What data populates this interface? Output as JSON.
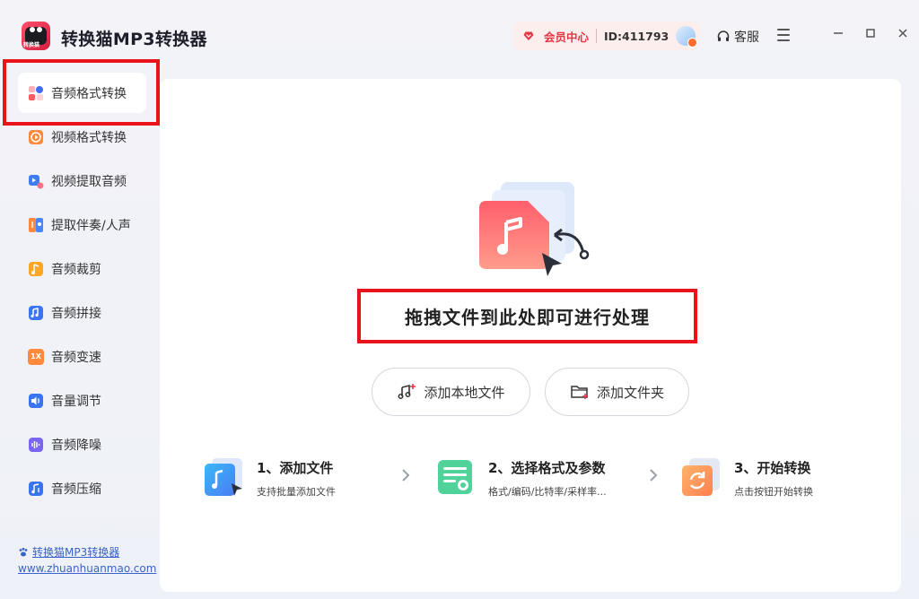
{
  "app": {
    "title": "转换猫MP3转换器",
    "logo_text": "转换猫"
  },
  "header": {
    "vip_label": "会员中心",
    "user_id": "ID:411793",
    "service_label": "客服"
  },
  "sidebar": {
    "items": [
      {
        "label": "音频格式转换",
        "icon": "audio-convert-icon",
        "active": true
      },
      {
        "label": "视频格式转换",
        "icon": "video-convert-icon"
      },
      {
        "label": "视频提取音频",
        "icon": "video-extract-audio-icon"
      },
      {
        "label": "提取伴奏/人声",
        "icon": "vocal-extract-icon"
      },
      {
        "label": "音频裁剪",
        "icon": "audio-cut-icon"
      },
      {
        "label": "音频拼接",
        "icon": "audio-merge-icon"
      },
      {
        "label": "音频变速",
        "icon": "audio-speed-icon"
      },
      {
        "label": "音量调节",
        "icon": "volume-icon"
      },
      {
        "label": "音频降噪",
        "icon": "denoise-icon"
      },
      {
        "label": "音频压缩",
        "icon": "compress-icon"
      }
    ],
    "speed_icon_text": "1X",
    "footer_brand": "转换猫MP3转换器",
    "footer_url": "www.zhuanhuanmao.com"
  },
  "main": {
    "drop_text": "拖拽文件到此处即可进行处理",
    "add_file_button": "添加本地文件",
    "add_folder_button": "添加文件夹",
    "steps": [
      {
        "title": "1、添加文件",
        "subtitle": "支持批量添加文件"
      },
      {
        "title": "2、选择格式及参数",
        "subtitle": "格式/编码/比特率/采样率..."
      },
      {
        "title": "3、开始转换",
        "subtitle": "点击按钮开始转换"
      }
    ]
  },
  "colors": {
    "accent_red": "#e23645",
    "highlight_box": "#e8131b",
    "link_blue": "#3a63c9"
  }
}
